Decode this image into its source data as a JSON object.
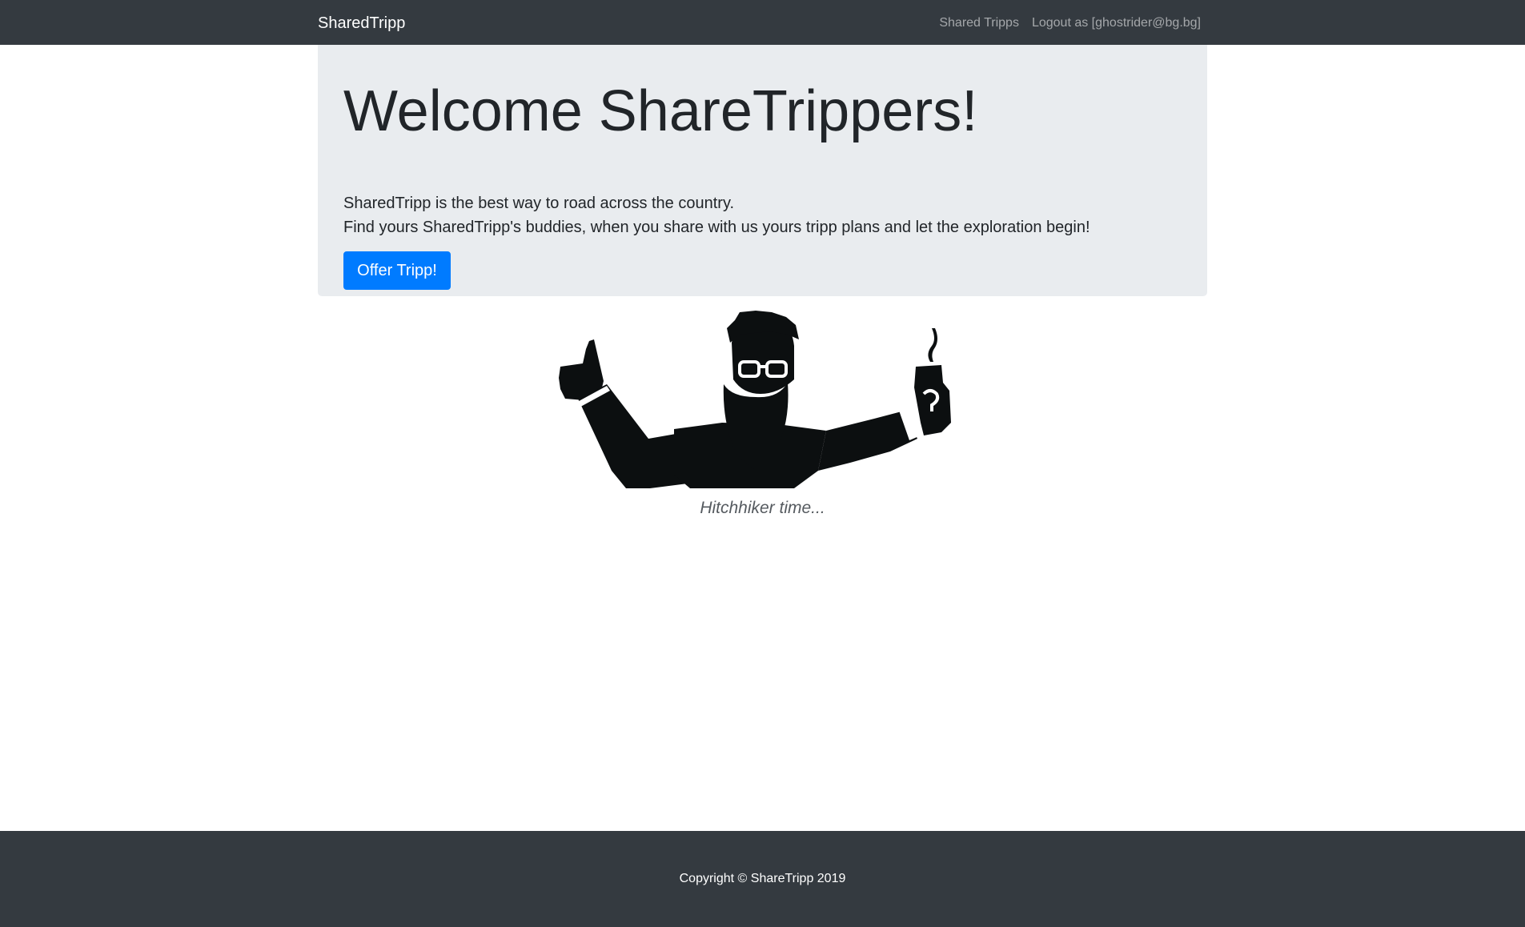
{
  "navbar": {
    "brand": "SharedTripp",
    "links": [
      {
        "label": "Shared Tripps"
      },
      {
        "label": "Logout as [ghostrider@bg.bg]"
      }
    ]
  },
  "jumbotron": {
    "title": "Welcome ShareTrippers!",
    "lead_1": "SharedTripp is the best way to road across the country.",
    "lead_2": "Find yours SharedTripp's buddies, when you share with us yours tripp plans and let the exploration begin!",
    "button_label": "Offer Tripp!"
  },
  "illustration": {
    "icon": "hitchhiker-illustration",
    "caption": "Hitchhiker time..."
  },
  "footer": {
    "copyright": "Copyright © ShareTripp 2019"
  },
  "colors": {
    "navbar_bg": "#343a40",
    "jumbotron_bg": "#e9ecef",
    "primary": "#007bff",
    "footer_bg": "#343a40"
  }
}
